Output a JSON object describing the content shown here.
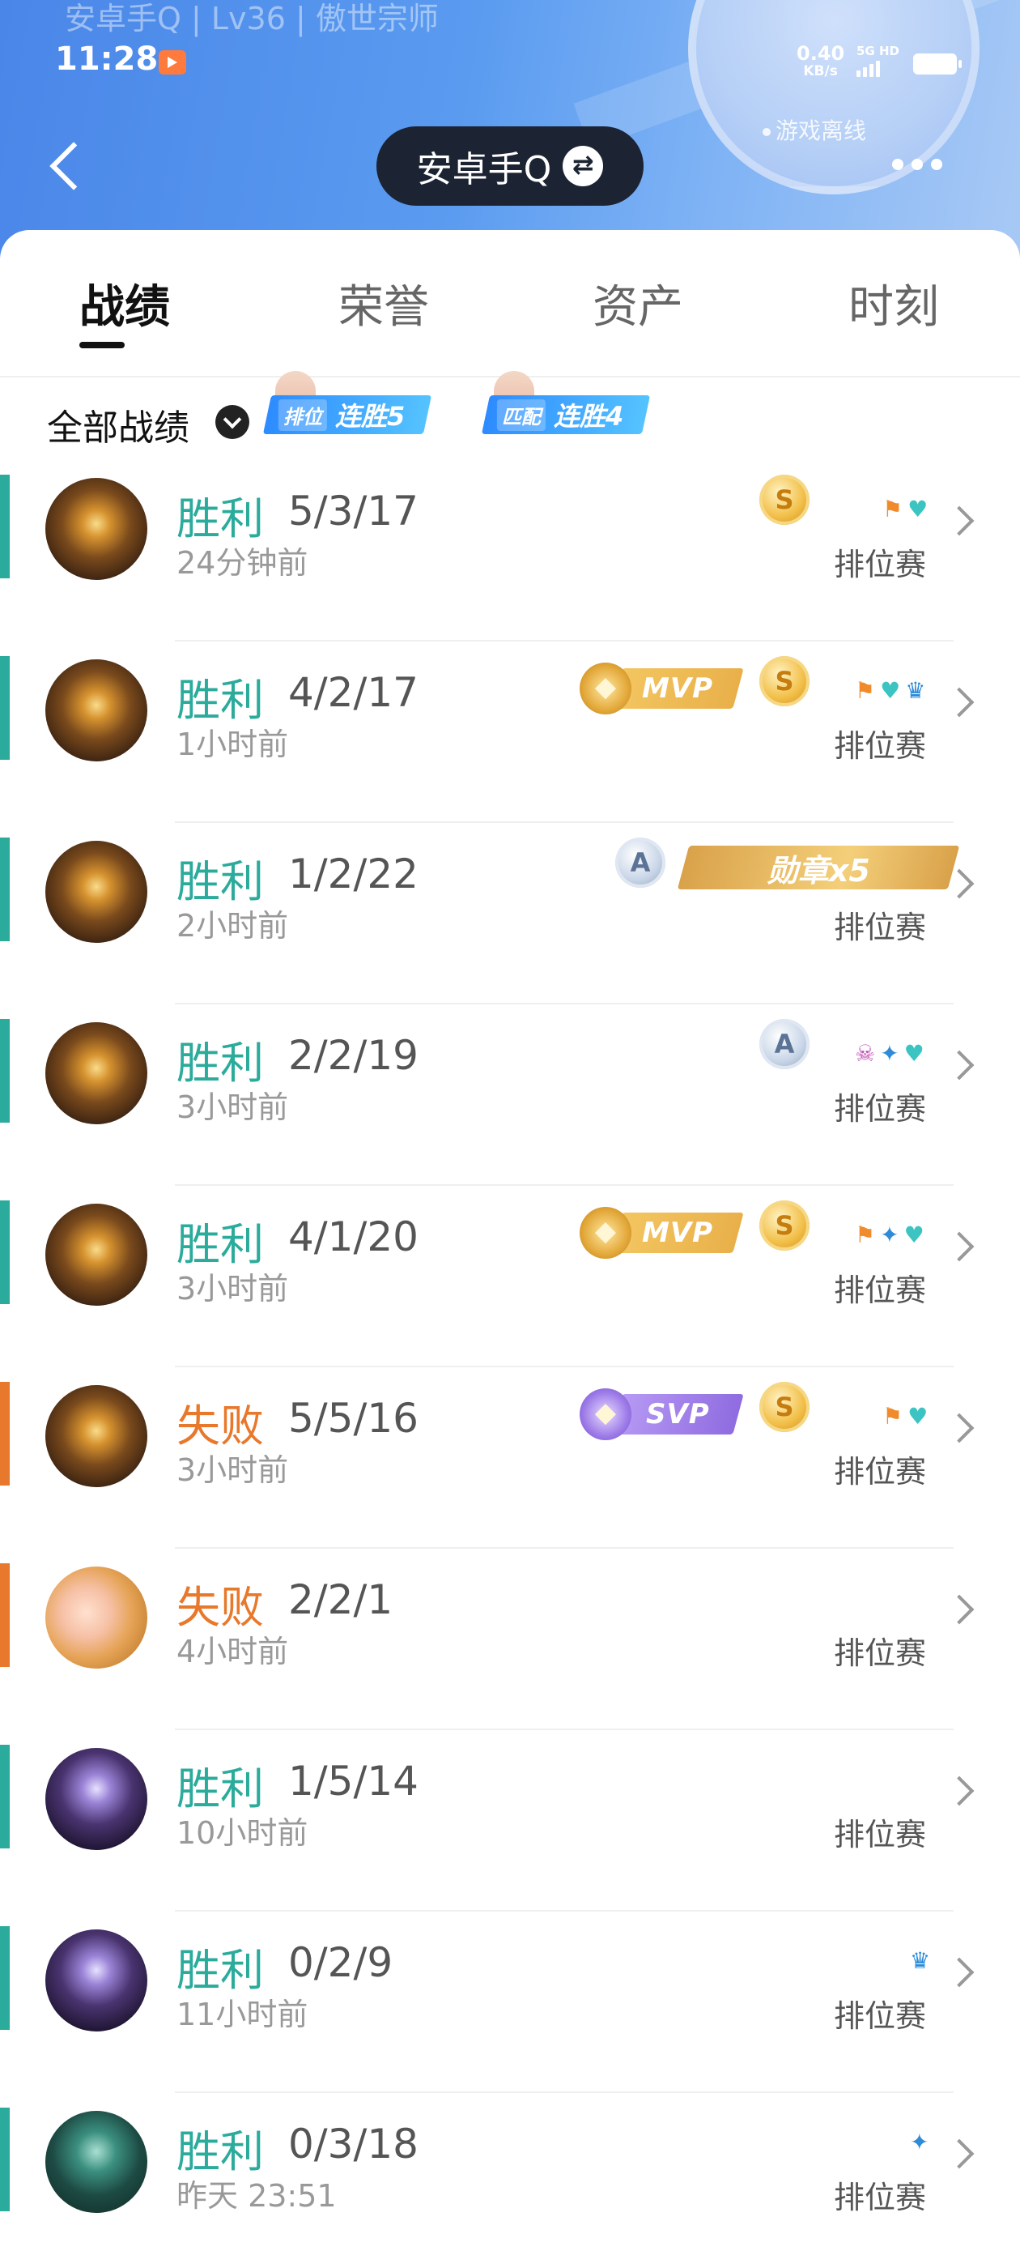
{
  "header": {
    "faded_top": "安卓手Q | Lv36 | 傲世宗师",
    "time": "11:28",
    "net_speed_value": "0.40",
    "net_speed_unit": "KB/s",
    "signal_label": "5G HD",
    "status": "游戏离线",
    "account_name": "安卓手Q"
  },
  "tabs": [
    {
      "label": "战绩",
      "active": true
    },
    {
      "label": "荣誉",
      "active": false
    },
    {
      "label": "资产",
      "active": false
    },
    {
      "label": "时刻",
      "active": false
    }
  ],
  "filter": {
    "label": "全部战绩",
    "streaks": [
      {
        "mode": "排位",
        "text": "连胜5"
      },
      {
        "mode": "匹配",
        "text": "连胜4"
      }
    ]
  },
  "colors": {
    "win": "#2bab9b",
    "loss": "#e8782b",
    "header_blue": "#4a86e8"
  },
  "matches": [
    {
      "result": "胜利",
      "outcome": "win",
      "kda": "5/3/17",
      "time": "24分钟前",
      "mode": "排位赛",
      "hero": "gold-hood",
      "badges": [
        "coin-S"
      ],
      "icons": [
        "flag",
        "heart"
      ]
    },
    {
      "result": "胜利",
      "outcome": "win",
      "kda": "4/2/17",
      "time": "1小时前",
      "mode": "排位赛",
      "hero": "gold-hood",
      "badges": [
        "mvp",
        "coin-S"
      ],
      "icons": [
        "flag",
        "heart",
        "cup"
      ]
    },
    {
      "result": "胜利",
      "outcome": "win",
      "kda": "1/2/22",
      "time": "2小时前",
      "mode": "排位赛",
      "hero": "gold-hood",
      "badges": [
        "coin-A",
        "medal"
      ],
      "icons": []
    },
    {
      "result": "胜利",
      "outcome": "win",
      "kda": "2/2/19",
      "time": "3小时前",
      "mode": "排位赛",
      "hero": "gold-hood",
      "badges": [
        "coin-A"
      ],
      "icons": [
        "skull",
        "wing",
        "heart"
      ]
    },
    {
      "result": "胜利",
      "outcome": "win",
      "kda": "4/1/20",
      "time": "3小时前",
      "mode": "排位赛",
      "hero": "gold-hood",
      "badges": [
        "mvp",
        "coin-S"
      ],
      "icons": [
        "flag",
        "wing",
        "heart"
      ]
    },
    {
      "result": "失败",
      "outcome": "loss",
      "kda": "5/5/16",
      "time": "3小时前",
      "mode": "排位赛",
      "hero": "gold-hood",
      "badges": [
        "svp",
        "coin-S"
      ],
      "icons": [
        "flag",
        "heart"
      ]
    },
    {
      "result": "失败",
      "outcome": "loss",
      "kda": "2/2/1",
      "time": "4小时前",
      "mode": "排位赛",
      "hero": "blonde",
      "badges": [],
      "icons": []
    },
    {
      "result": "胜利",
      "outcome": "win",
      "kda": "1/5/14",
      "time": "10小时前",
      "mode": "排位赛",
      "hero": "purple-mech",
      "badges": [],
      "icons": []
    },
    {
      "result": "胜利",
      "outcome": "win",
      "kda": "0/2/9",
      "time": "11小时前",
      "mode": "排位赛",
      "hero": "purple-mech",
      "badges": [],
      "icons": [
        "cup"
      ]
    },
    {
      "result": "胜利",
      "outcome": "win",
      "kda": "0/3/18",
      "time": "昨天 23:51",
      "mode": "排位赛",
      "hero": "teal-dark",
      "badges": [],
      "icons": [
        "wing"
      ]
    }
  ],
  "badge_text": {
    "mvp": "MVP",
    "svp": "SVP",
    "medal": "勋章x5",
    "coin_S": "S",
    "coin_A": "A"
  }
}
